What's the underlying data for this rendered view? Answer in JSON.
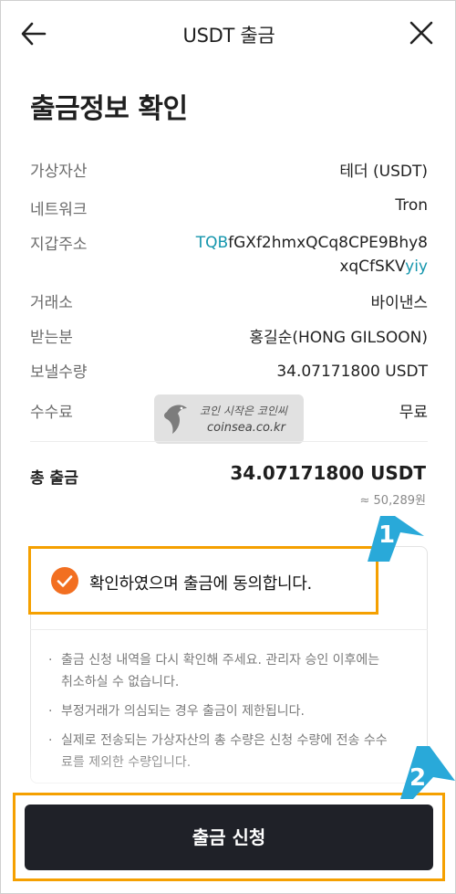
{
  "header": {
    "title": "USDT 출금",
    "back_icon": "arrow-left-icon",
    "close_icon": "close-icon"
  },
  "page_title": "출금정보 확인",
  "details": {
    "asset": {
      "label": "가상자산",
      "value": "테더 (USDT)"
    },
    "network": {
      "label": "네트워크",
      "value": "Tron"
    },
    "address": {
      "label": "지갑주소",
      "prefix": "TQB",
      "middle1": "fGXf2hmxQCq8CPE9Bhy8",
      "middle2": "xqCfSKV",
      "suffix": "yiy"
    },
    "exchange": {
      "label": "거래소",
      "value": "바이낸스"
    },
    "recipient": {
      "label": "받는분",
      "value": "홍길순(HONG GILSOON)"
    },
    "send_amount": {
      "label": "보낼수량",
      "value": "34.07171800 USDT"
    },
    "fee": {
      "label": "수수료",
      "value": "무료"
    }
  },
  "total": {
    "label": "총 출금",
    "value": "34.07171800 USDT",
    "krw": "≈ 50,289원"
  },
  "watermark": {
    "line1": "코인 시작은 코인씨",
    "line2": "coinsea.co.kr"
  },
  "agree": {
    "text": "확인하였으며 출금에 동의합니다.",
    "checked": true
  },
  "notes": [
    "출금 신청 내역을 다시 확인해 주세요. 관리자 승인 이후에는 취소하실 수 없습니다.",
    "부정거래가 의심되는 경우 출금이 제한됩니다.",
    "실제로 전송되는 가상자산의 총 수량은 신청 수량에 전송 수수료를 제외한 수량입니다."
  ],
  "submit_label": "출금 신청",
  "callouts": [
    "1",
    "2"
  ],
  "colors": {
    "accent_orange": "#f26f21",
    "highlight_border": "#f5a000",
    "address_teal": "#1596ad",
    "button_dark": "#1f2128",
    "callout_blue": "#29a9d9"
  }
}
